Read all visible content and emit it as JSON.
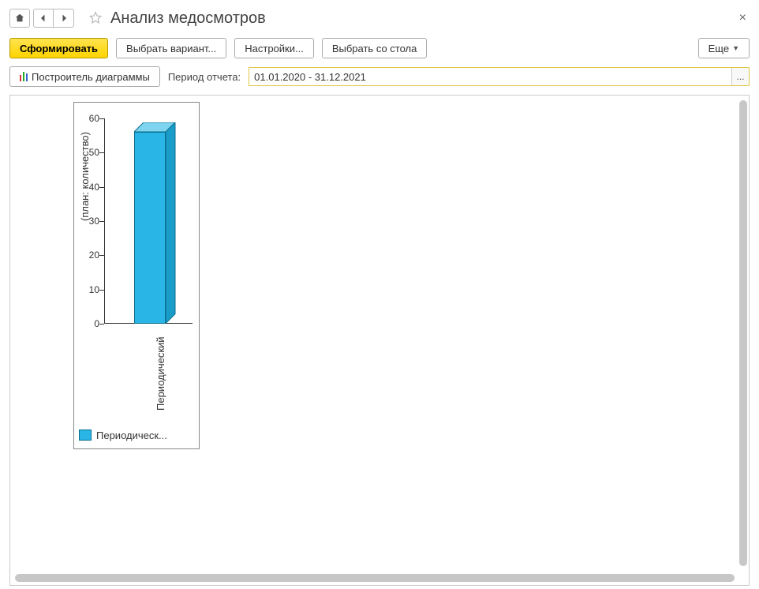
{
  "header": {
    "title": "Анализ медосмотров"
  },
  "toolbar": {
    "generate": "Сформировать",
    "choose_variant": "Выбрать вариант...",
    "settings": "Настройки...",
    "choose_from_table": "Выбрать со стола",
    "more": "Еще",
    "chart_builder": "Построитель диаграммы"
  },
  "params": {
    "period_label": "Период отчета:",
    "period_value": "01.01.2020 - 31.12.2021",
    "picker_btn": "..."
  },
  "chart_data": {
    "type": "bar",
    "categories": [
      "Периодический"
    ],
    "values": [
      56
    ],
    "ylabel": "(план: количество)",
    "ylim": [
      0,
      60
    ],
    "yticks": [
      0,
      10,
      20,
      30,
      40,
      50,
      60
    ],
    "legend": "Периодическ...",
    "series_color": "#29b6e6"
  }
}
